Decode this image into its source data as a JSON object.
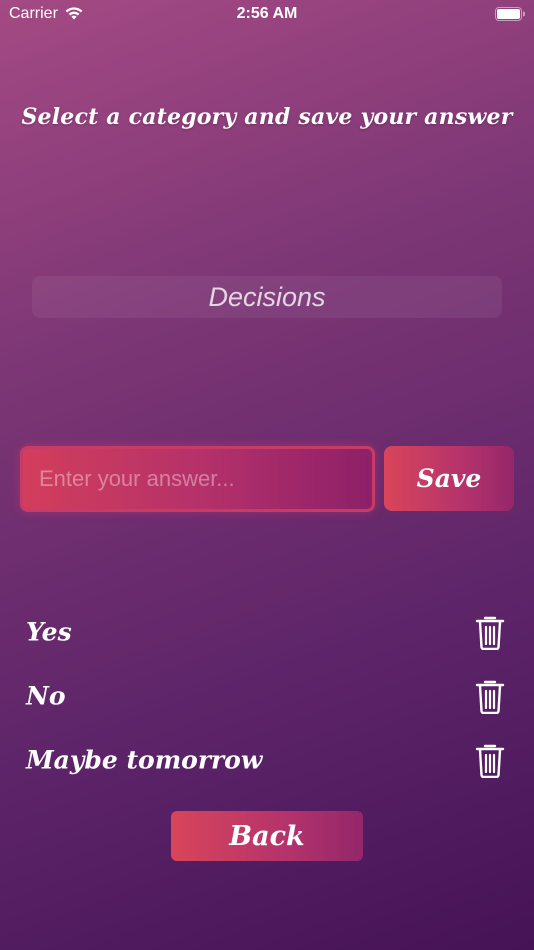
{
  "status_bar": {
    "carrier": "Carrier",
    "time": "2:56 AM"
  },
  "header": {
    "title": "Select a category and save your answer"
  },
  "category": {
    "selected": "Decisions"
  },
  "answer_input": {
    "value": "",
    "placeholder": "Enter your answer..."
  },
  "save_button": {
    "label": "Save"
  },
  "answers": [
    {
      "text": "Yes",
      "icon": "trash-icon"
    },
    {
      "text": "No",
      "icon": "trash-icon"
    },
    {
      "text": "Maybe tomorrow",
      "icon": "trash-icon"
    }
  ],
  "back_button": {
    "label": "Back"
  },
  "colors": {
    "background_top": "#a44a84",
    "background_bottom": "#461356",
    "accent": "#d9455a",
    "input_border": "#c93b67"
  }
}
